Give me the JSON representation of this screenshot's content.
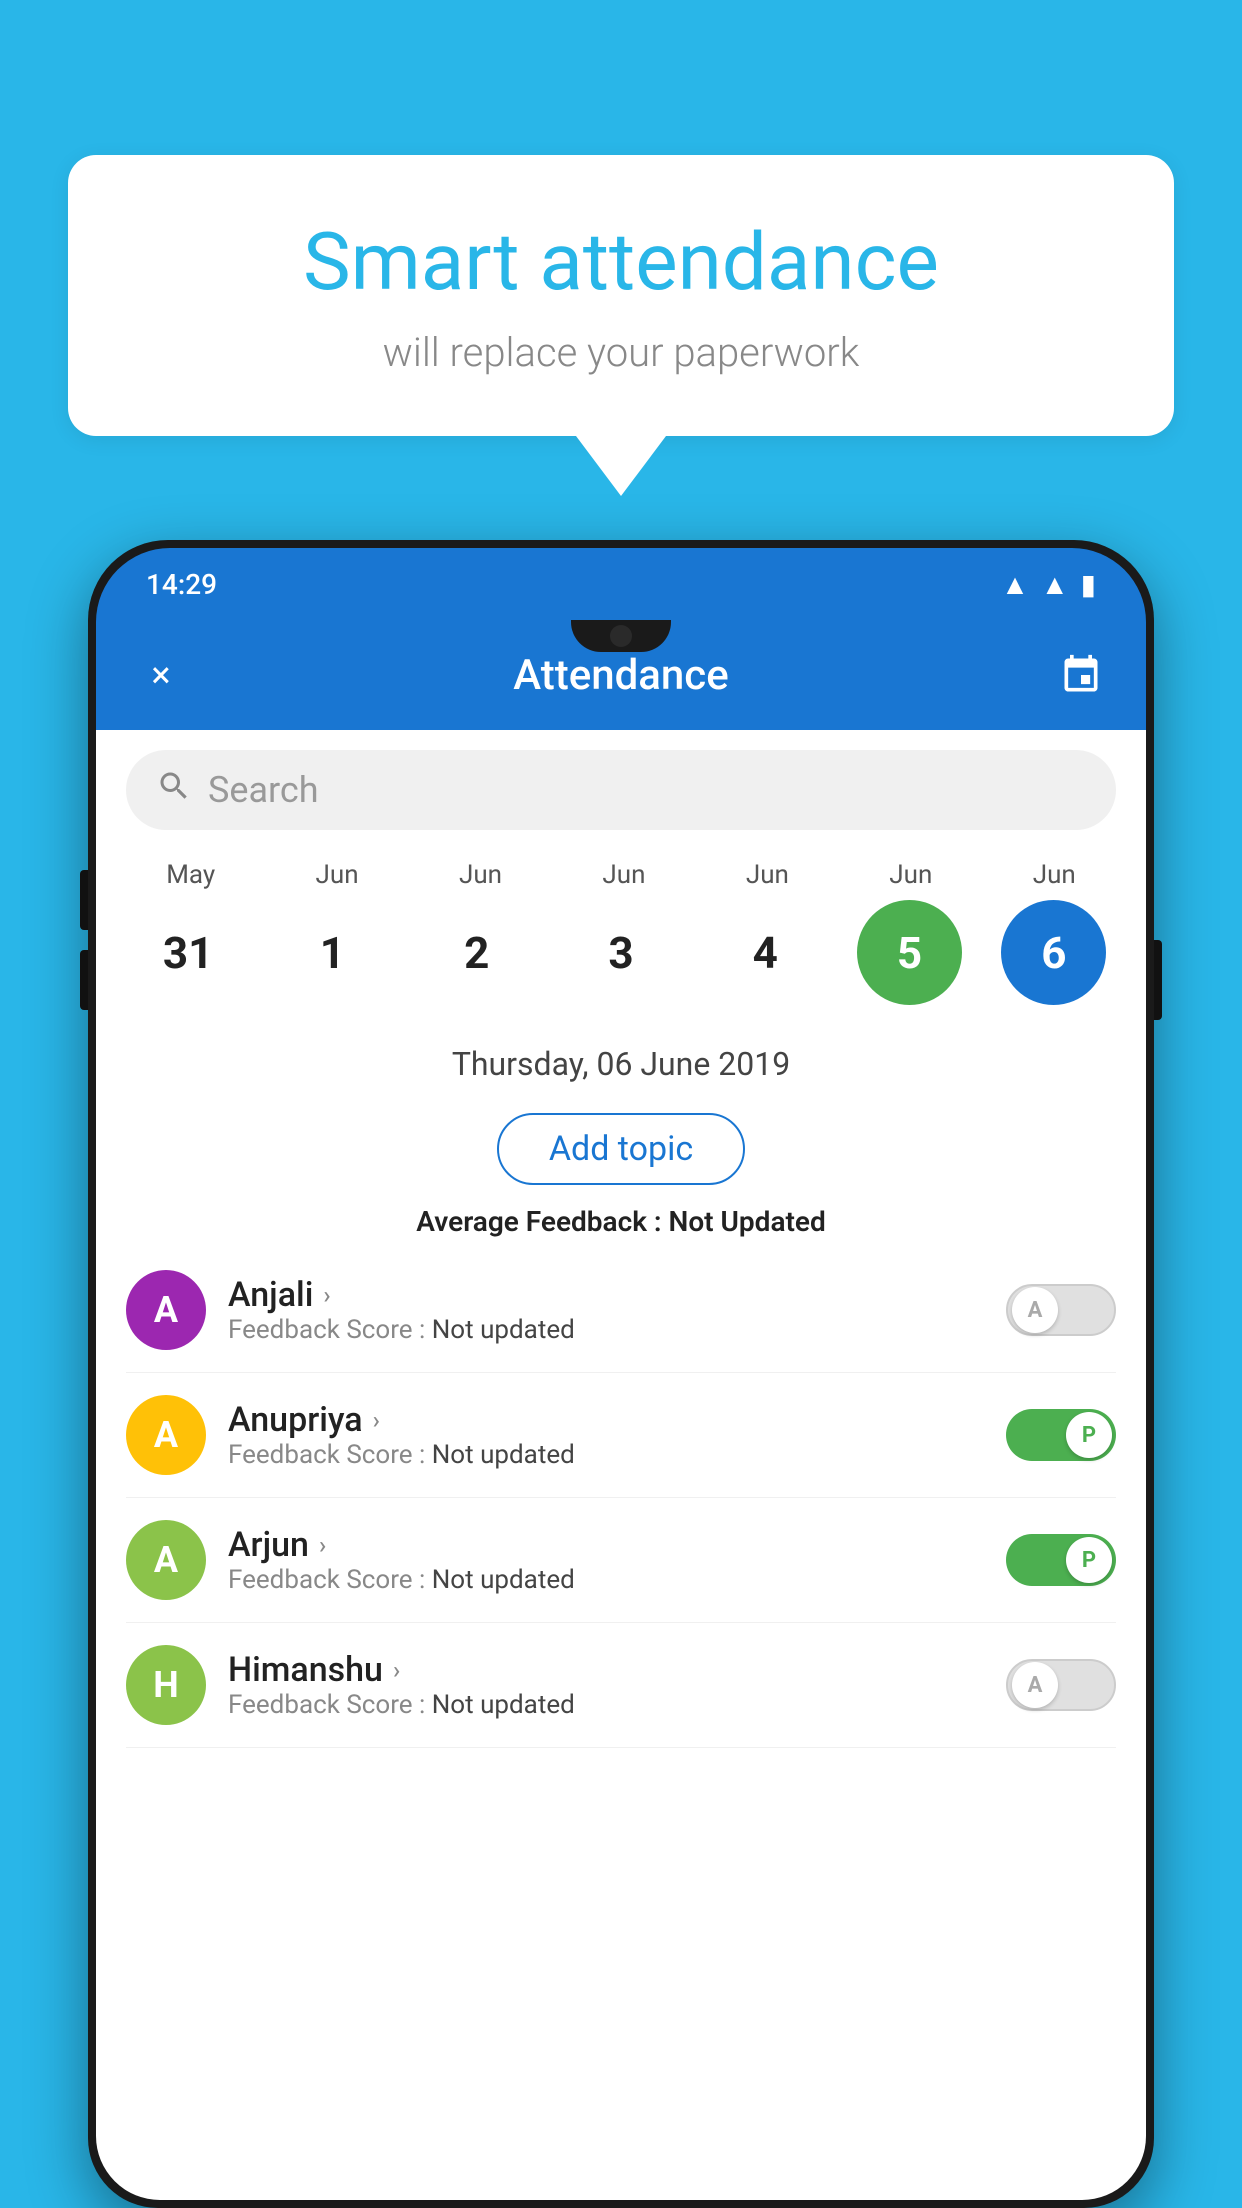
{
  "background_color": "#29b6e8",
  "speech_bubble": {
    "title": "Smart attendance",
    "subtitle": "will replace your paperwork"
  },
  "status_bar": {
    "time": "14:29",
    "icons": [
      "wifi",
      "signal",
      "battery"
    ]
  },
  "app_bar": {
    "title": "Attendance",
    "close_label": "×",
    "calendar_icon": "📅"
  },
  "search": {
    "placeholder": "Search"
  },
  "calendar": {
    "months": [
      "May",
      "Jun",
      "Jun",
      "Jun",
      "Jun",
      "Jun",
      "Jun"
    ],
    "dates": [
      "31",
      "1",
      "2",
      "3",
      "4",
      "5",
      "6"
    ],
    "today_index": 5,
    "selected_index": 6
  },
  "selected_date_label": "Thursday, 06 June 2019",
  "add_topic_label": "Add topic",
  "avg_feedback_label": "Average Feedback :",
  "avg_feedback_value": "Not Updated",
  "students": [
    {
      "name": "Anjali",
      "avatar_letter": "A",
      "avatar_color": "#9c27b0",
      "feedback_label": "Feedback Score :",
      "feedback_value": "Not updated",
      "toggle_state": "off",
      "toggle_label": "A"
    },
    {
      "name": "Anupriya",
      "avatar_letter": "A",
      "avatar_color": "#ffc107",
      "feedback_label": "Feedback Score :",
      "feedback_value": "Not updated",
      "toggle_state": "on",
      "toggle_label": "P"
    },
    {
      "name": "Arjun",
      "avatar_letter": "A",
      "avatar_color": "#8bc34a",
      "feedback_label": "Feedback Score :",
      "feedback_value": "Not updated",
      "toggle_state": "on",
      "toggle_label": "P"
    },
    {
      "name": "Himanshu",
      "avatar_letter": "H",
      "avatar_color": "#8bc34a",
      "feedback_label": "Feedback Score :",
      "feedback_value": "Not updated",
      "toggle_state": "off",
      "toggle_label": "A"
    }
  ]
}
